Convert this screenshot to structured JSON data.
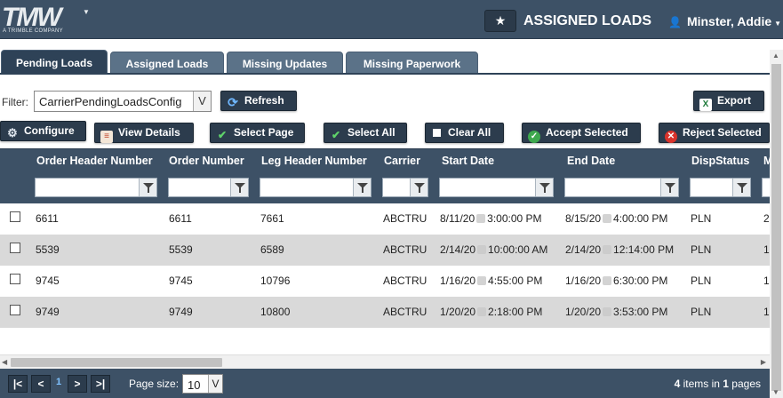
{
  "header": {
    "logo_text": "TMW",
    "logo_sub": "A TRIMBLE COMPANY",
    "page_title": "ASSIGNED LOADS",
    "user_name": "Minster, Addie"
  },
  "tabs": [
    {
      "label": "Pending Loads",
      "active": true
    },
    {
      "label": "Assigned Loads",
      "active": false
    },
    {
      "label": "Missing Updates",
      "active": false
    },
    {
      "label": "Missing Paperwork",
      "active": false
    }
  ],
  "toolbar": {
    "filter_label": "Filter:",
    "filter_value": "CarrierPendingLoadsConfig",
    "refresh_label": "Refresh",
    "export_label": "Export",
    "configure_label": "Configure",
    "view_details_label": "View Details",
    "select_page_label": "Select Page",
    "select_all_label": "Select All",
    "clear_all_label": "Clear All",
    "accept_selected_label": "Accept Selected",
    "reject_selected_label": "Reject Selected"
  },
  "grid": {
    "columns": [
      "Order Header Number",
      "Order Number",
      "Leg Header Number",
      "Carrier",
      "Start Date",
      "End Date",
      "DispStatus",
      "M"
    ],
    "rows": [
      {
        "ohn": "6611",
        "on": "6611",
        "lhn": "7661",
        "carrier": "ABCTRU",
        "start_a": "8/11/20",
        "start_b": "3:00:00 PM",
        "end_a": "8/15/20",
        "end_b": "4:00:00 PM",
        "status": "PLN",
        "m": "2"
      },
      {
        "ohn": "5539",
        "on": "5539",
        "lhn": "6589",
        "carrier": "ABCTRU",
        "start_a": "2/14/20",
        "start_b": "10:00:00 AM",
        "end_a": "2/14/20",
        "end_b": "12:14:00 PM",
        "status": "PLN",
        "m": "1"
      },
      {
        "ohn": "9745",
        "on": "9745",
        "lhn": "10796",
        "carrier": "ABCTRU",
        "start_a": "1/16/20",
        "start_b": "4:55:00 PM",
        "end_a": "1/16/20",
        "end_b": "6:30:00 PM",
        "status": "PLN",
        "m": "1"
      },
      {
        "ohn": "9749",
        "on": "9749",
        "lhn": "10800",
        "carrier": "ABCTRU",
        "start_a": "1/20/20",
        "start_b": "2:18:00 PM",
        "end_a": "1/20/20",
        "end_b": "3:53:00 PM",
        "status": "PLN",
        "m": "1"
      }
    ]
  },
  "pager": {
    "first": "|<",
    "prev": "<",
    "current_page": "1",
    "next": ">",
    "last": ">|",
    "page_size_label": "Page size:",
    "page_size": "10",
    "items_count": "4",
    "items_mid": " items in ",
    "pages_count": "1",
    "pages_suffix": " pages"
  }
}
